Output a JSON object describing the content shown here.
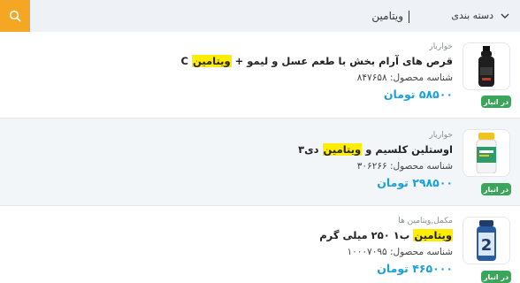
{
  "search": {
    "category_label": "دسته بندی",
    "query": "ویتامین"
  },
  "results": [
    {
      "category": "خواربار",
      "name_before": "قرص های آرام بخش با طعم عسل و لیمو + ",
      "name_highlight": "ویتامین",
      "name_after": " C",
      "sku_label": "شناسه محصول:",
      "sku": "۸۴۷۶۵۸",
      "price": "۵۸۵۰۰ تومان",
      "stock": "در انبار"
    },
    {
      "category": "خواربار",
      "name_before": "اوستلین کلسیم و ",
      "name_highlight": "ویتامین",
      "name_after": " دی۳",
      "sku_label": "شناسه محصول:",
      "sku": "۳۰۶۲۶۶",
      "price": "۲۹۸۵۰۰ تومان",
      "stock": "در انبار"
    },
    {
      "category": "مکمل,ویتامین ها",
      "name_before": "",
      "name_highlight": "ویتامین",
      "name_after": " ب۱ ۲۵۰ میلی گرم",
      "sku_label": "شناسه محصول:",
      "sku": "۱۰۰۰۷۰۹۵",
      "price": "۴۶۵۰۰۰ تومان",
      "stock": "در انبار"
    }
  ],
  "colors": {
    "search_button": "#f5a623",
    "highlight": "#ffee00",
    "price": "#1aa0d8",
    "stock_badge": "#3ba55c"
  }
}
